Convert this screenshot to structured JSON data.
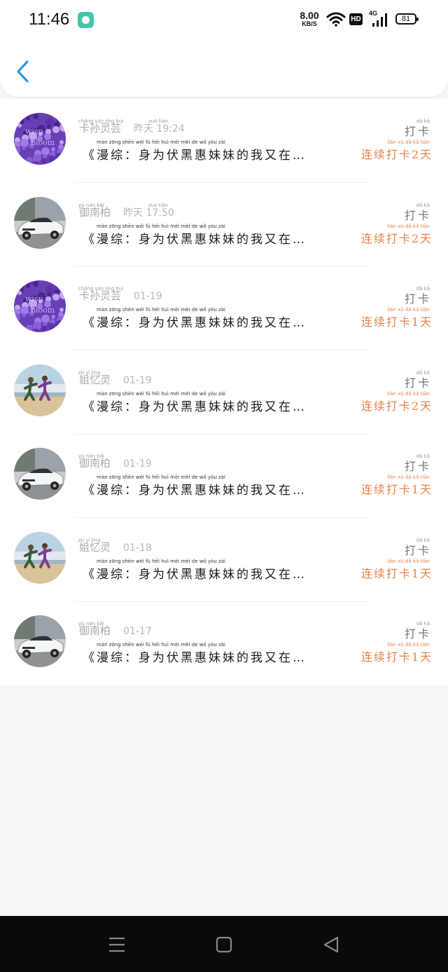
{
  "status_bar": {
    "time": "11:46",
    "speed_value": "8.00",
    "speed_unit": "KB/S",
    "hd": "HD",
    "network": "4G",
    "battery": "81",
    "notif_icon": "chat-bubble-icon",
    "wifi_icon": "wifi-icon",
    "signal_icon": "signal-icon"
  },
  "header": {
    "back_icon": "chevron-left-icon"
  },
  "rows": [
    {
      "name": "卡孙灵芸",
      "name_pinyin": "chǎng sūn líng huì",
      "date": "昨天 19:24",
      "date_pinyin": "zuó tiān",
      "action": "打卡",
      "action_pinyin": "dǎ kǎ",
      "message": "《漫综：身为伏黑惠妹妹的我又在…",
      "message_pinyin": "màn zōng   shēn wéi fú hēi huì mèi mèi de wǒ yòu zài",
      "streak": "连续打卡2天",
      "streak_pinyin": "lián xù dǎ kǎ tiān",
      "avatar": "purple-flowers"
    },
    {
      "name": "御南柏",
      "name_pinyin": "yù nán bǎi",
      "date": "昨天 17:50",
      "date_pinyin": "zuó tiān",
      "action": "打卡",
      "action_pinyin": "dǎ kǎ",
      "message": "《漫综：身为伏黑惠妹妹的我又在…",
      "message_pinyin": "màn zōng   shēn wéi fú hēi huì mèi mèi de wǒ yòu zài",
      "streak": "连续打卡2天",
      "streak_pinyin": "lián xù dǎ kǎ tiān",
      "avatar": "white-car"
    },
    {
      "name": "卡孙灵芸",
      "name_pinyin": "chǎng sūn líng huì",
      "date": "01-19",
      "date_pinyin": "",
      "action": "打卡",
      "action_pinyin": "dǎ kǎ",
      "message": "《漫综：身为伏黑惠妹妹的我又在…",
      "message_pinyin": "màn zōng   shēn wéi fú hēi huì mèi mèi de wǒ yòu zài",
      "streak": "连续打卡1天",
      "streak_pinyin": "lián xù dǎ kǎ tiān",
      "avatar": "purple-flowers"
    },
    {
      "name": "姐忆灵",
      "name_pinyin": "zǔ yì líng",
      "date": "01-19",
      "date_pinyin": "",
      "action": "打卡",
      "action_pinyin": "dǎ kǎ",
      "message": "《漫综：身为伏黑惠妹妹的我又在…",
      "message_pinyin": "màn zōng   shēn wéi fú hēi huì mèi mèi de wǒ yòu zài",
      "streak": "连续打卡2天",
      "streak_pinyin": "lián xù dǎ kǎ tiān",
      "avatar": "running-couple"
    },
    {
      "name": "御南柏",
      "name_pinyin": "yù nán bǎi",
      "date": "01-19",
      "date_pinyin": "",
      "action": "打卡",
      "action_pinyin": "dǎ kǎ",
      "message": "《漫综：身为伏黑惠妹妹的我又在…",
      "message_pinyin": "màn zōng   shēn wéi fú hēi huì mèi mèi de wǒ yòu zài",
      "streak": "连续打卡1天",
      "streak_pinyin": "lián xù dǎ kǎ tiān",
      "avatar": "white-car"
    },
    {
      "name": "姐忆灵",
      "name_pinyin": "zǔ yì líng",
      "date": "01-18",
      "date_pinyin": "",
      "action": "打卡",
      "action_pinyin": "dǎ kǎ",
      "message": "《漫综：身为伏黑惠妹妹的我又在…",
      "message_pinyin": "màn zōng   shēn wéi fú hēi huì mèi mèi de wǒ yòu zài",
      "streak": "连续打卡1天",
      "streak_pinyin": "lián xù dǎ kǎ tiān",
      "avatar": "running-couple"
    },
    {
      "name": "御南柏",
      "name_pinyin": "yù nán bǎi",
      "date": "01-17",
      "date_pinyin": "",
      "action": "打卡",
      "action_pinyin": "dǎ kǎ",
      "message": "《漫综：身为伏黑惠妹妹的我又在…",
      "message_pinyin": "màn zōng   shēn wéi fú hēi huì mèi mèi de wǒ yòu zài",
      "streak": "连续打卡1天",
      "streak_pinyin": "lián xù dǎ kǎ tiān",
      "avatar": "white-car"
    }
  ],
  "nav_bar": {
    "menu_icon": "menu-icon",
    "home_icon": "home-square-icon",
    "back_icon": "back-triangle-icon"
  },
  "colors": {
    "accent_orange": "#e8834a",
    "back_blue": "#2b9be8",
    "nav_bg": "#0a0a0a",
    "page_bg": "#f7f5f6"
  }
}
